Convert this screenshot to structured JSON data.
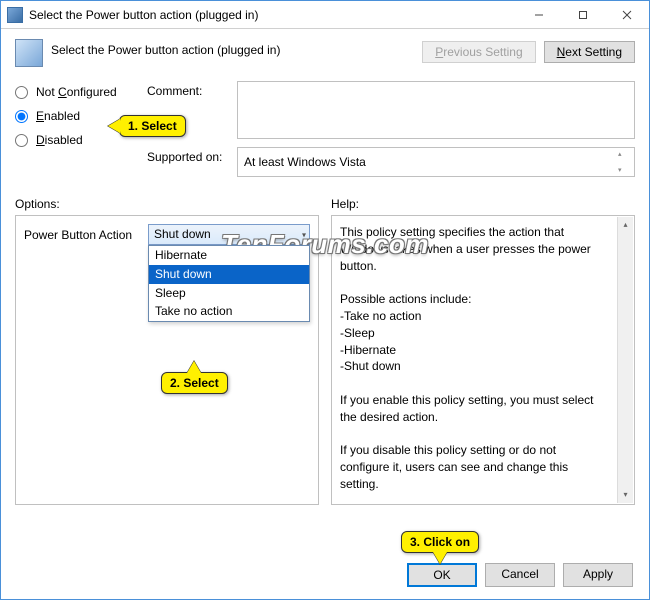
{
  "window": {
    "title": "Select the Power button action (plugged in)"
  },
  "header": {
    "title": "Select the Power button action (plugged in)",
    "prev": "Previous Setting",
    "next": "Next Setting"
  },
  "radios": {
    "not_configured": "Not Configured",
    "enabled": "Enabled",
    "disabled": "Disabled",
    "selected": "enabled"
  },
  "labels": {
    "comment": "Comment:",
    "supported_on": "Supported on:",
    "options": "Options:",
    "help": "Help:",
    "power_button_action": "Power Button Action"
  },
  "fields": {
    "comment": "",
    "supported_on": "At least Windows Vista"
  },
  "combo": {
    "selected": "Shut down",
    "options": [
      "Hibernate",
      "Shut down",
      "Sleep",
      "Take no action"
    ],
    "highlighted": "Shut down"
  },
  "help": {
    "p1": "This policy setting specifies the action that Windows takes when a user presses the power button.",
    "p2": "Possible actions include:",
    "b1": "-Take no action",
    "b2": "-Sleep",
    "b3": "-Hibernate",
    "b4": "-Shut down",
    "p3": "If you enable this policy setting, you must select the desired action.",
    "p4": "If you disable this policy setting or do not configure it, users can see and change this setting."
  },
  "actions": {
    "ok": "OK",
    "cancel": "Cancel",
    "apply": "Apply"
  },
  "callouts": {
    "c1": "1. Select",
    "c2": "2. Select",
    "c3": "3. Click on"
  },
  "watermark": "TenForums.com"
}
